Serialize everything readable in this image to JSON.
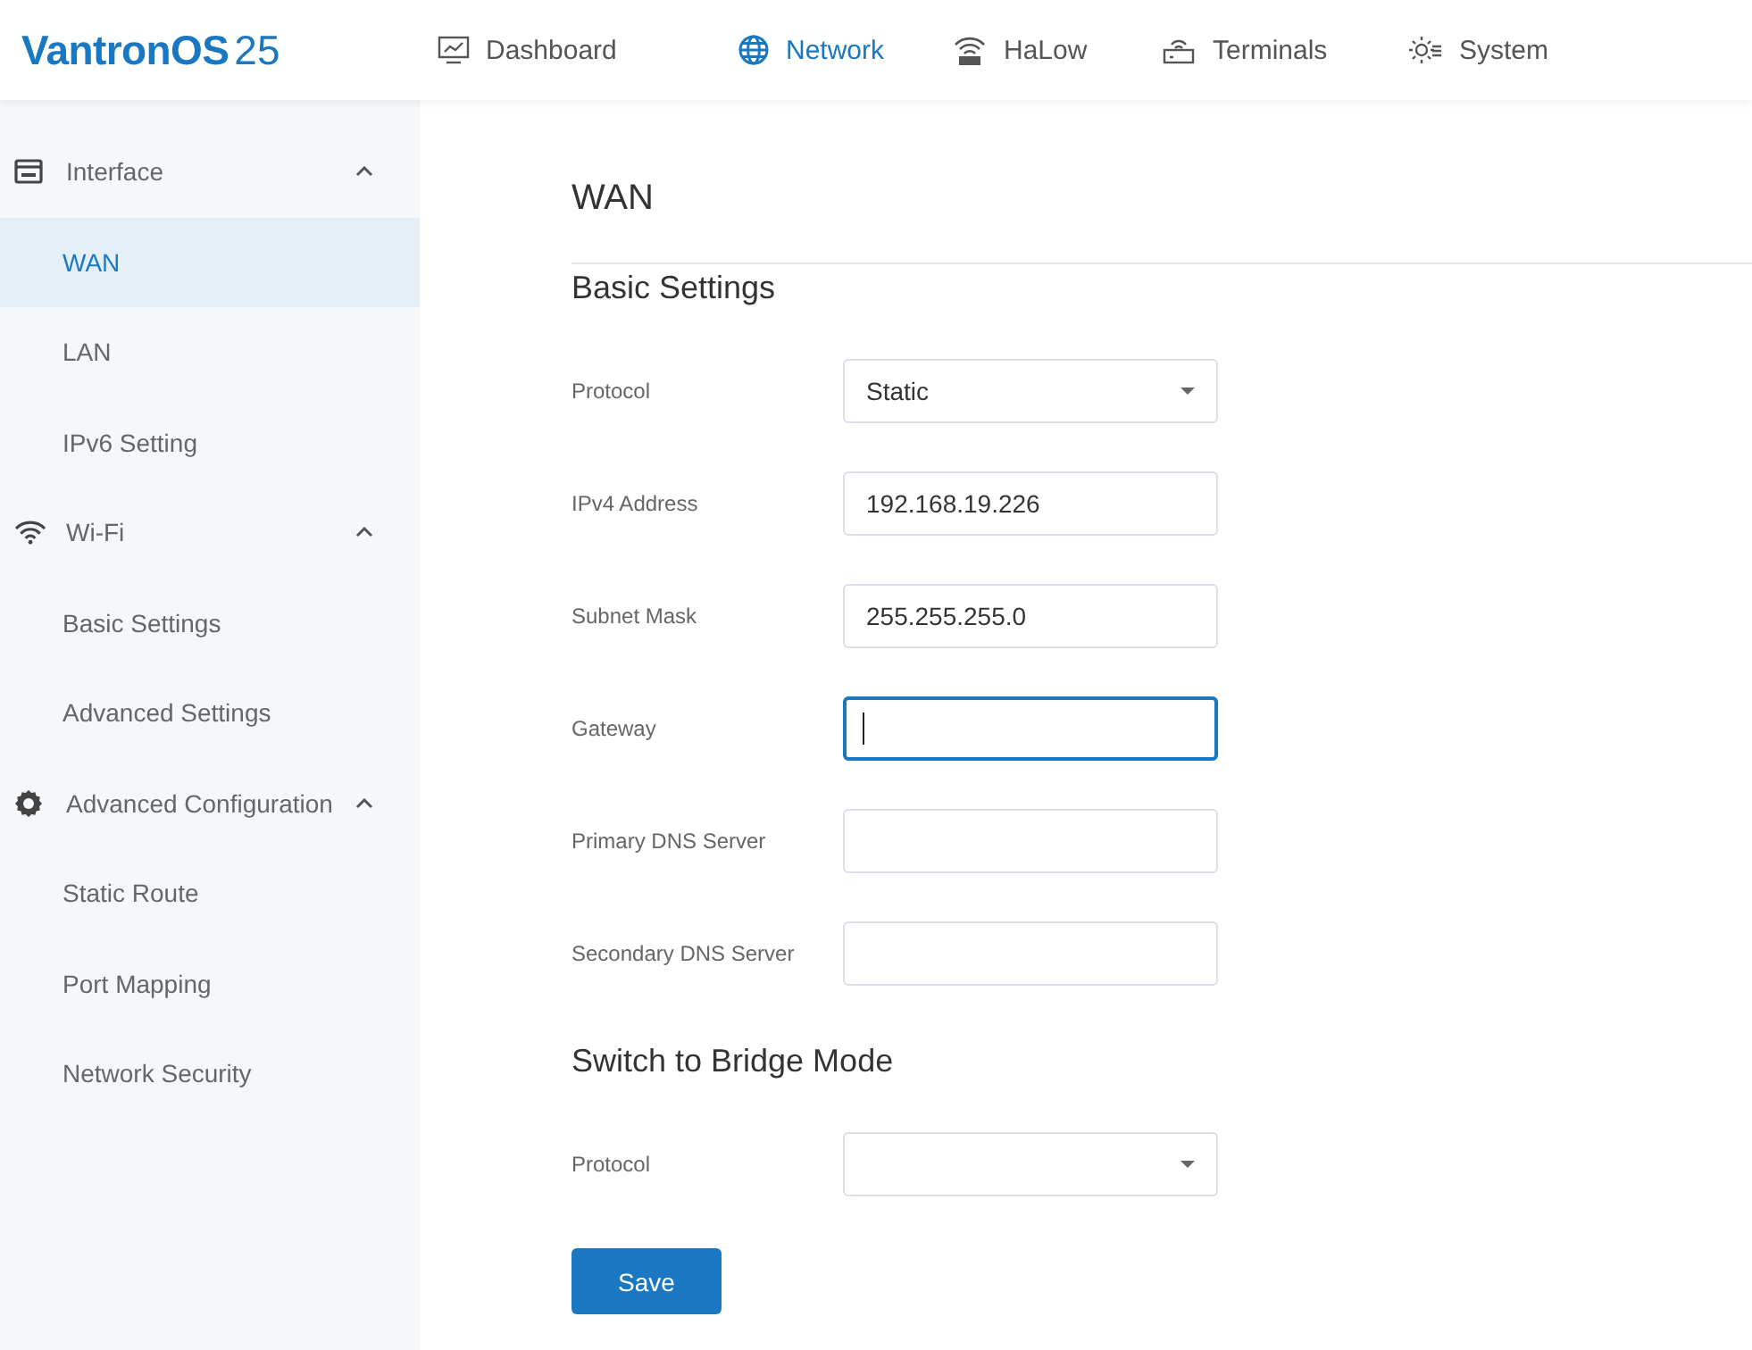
{
  "brand": {
    "name": "VantronOS",
    "version": "25"
  },
  "nav": [
    {
      "label": "Dashboard",
      "selected": false
    },
    {
      "label": "Network",
      "selected": true
    },
    {
      "label": "HaLow",
      "selected": false
    },
    {
      "label": "Terminals",
      "selected": false
    },
    {
      "label": "System",
      "selected": false
    }
  ],
  "sidebar": [
    {
      "label": "Interface",
      "expanded": true,
      "children": [
        {
          "label": "WAN",
          "selected": true
        },
        {
          "label": "LAN",
          "selected": false
        },
        {
          "label": "IPv6 Setting",
          "selected": false
        }
      ]
    },
    {
      "label": "Wi-Fi",
      "expanded": true,
      "children": [
        {
          "label": "Basic Settings",
          "selected": false
        },
        {
          "label": "Advanced Settings",
          "selected": false
        }
      ]
    },
    {
      "label": "Advanced Configuration",
      "expanded": true,
      "children": [
        {
          "label": "Static Route",
          "selected": false
        },
        {
          "label": "Port Mapping",
          "selected": false
        },
        {
          "label": "Network Security",
          "selected": false
        }
      ]
    }
  ],
  "page": {
    "title": "WAN",
    "sections": [
      {
        "title": "Basic Settings",
        "fields": [
          {
            "label": "Protocol",
            "kind": "select",
            "value": "Static",
            "focused": false
          },
          {
            "label": "IPv4 Address",
            "kind": "input",
            "value": "192.168.19.226",
            "focused": false
          },
          {
            "label": "Subnet Mask",
            "kind": "input",
            "value": "255.255.255.0",
            "focused": false
          },
          {
            "label": "Gateway",
            "kind": "input",
            "focused": true
          },
          {
            "label": "Primary DNS Server",
            "kind": "input",
            "focused": false
          },
          {
            "label": "Secondary DNS Server",
            "kind": "input",
            "focused": false
          }
        ]
      },
      {
        "title": "Switch to Bridge Mode",
        "fields": [
          {
            "label": "Protocol",
            "kind": "select",
            "focused": false
          }
        ]
      }
    ],
    "save_button": "Save"
  }
}
